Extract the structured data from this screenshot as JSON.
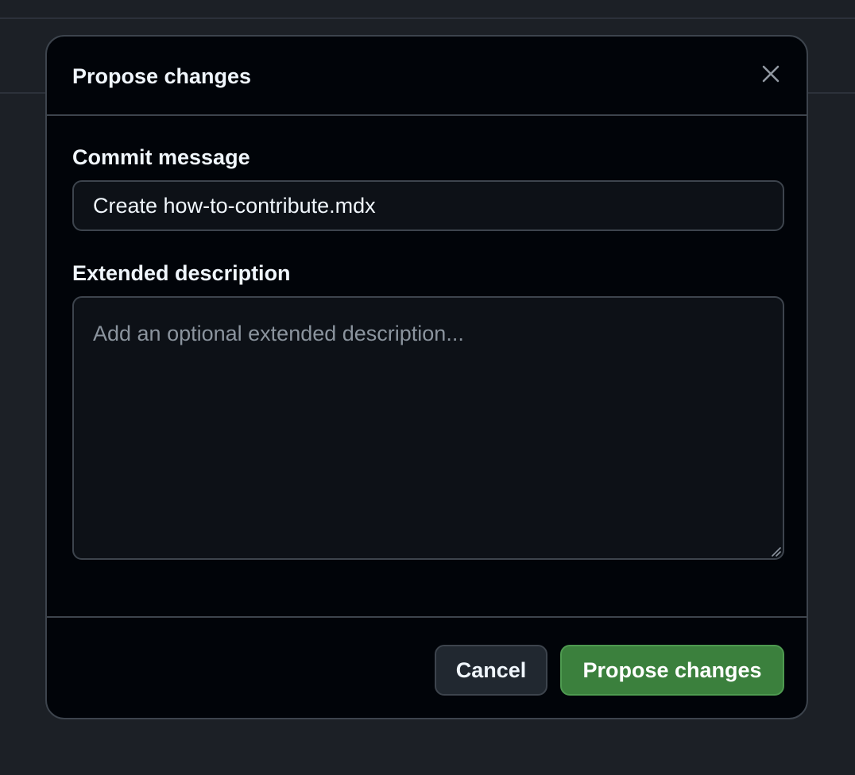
{
  "dialog": {
    "title": "Propose changes",
    "close_icon": "close-icon"
  },
  "commit_message": {
    "label": "Commit message",
    "value": "Create how-to-contribute.mdx"
  },
  "extended_description": {
    "label": "Extended description",
    "placeholder": "Add an optional extended description...",
    "value": ""
  },
  "footer": {
    "cancel_label": "Cancel",
    "propose_label": "Propose changes"
  },
  "colors": {
    "dialog_background": "#010409",
    "input_background": "#0d1117",
    "border": "#3d444d",
    "primary_button": "#3b803d",
    "secondary_button": "#212830",
    "text": "#f0f6fc",
    "placeholder": "#8b949e"
  }
}
